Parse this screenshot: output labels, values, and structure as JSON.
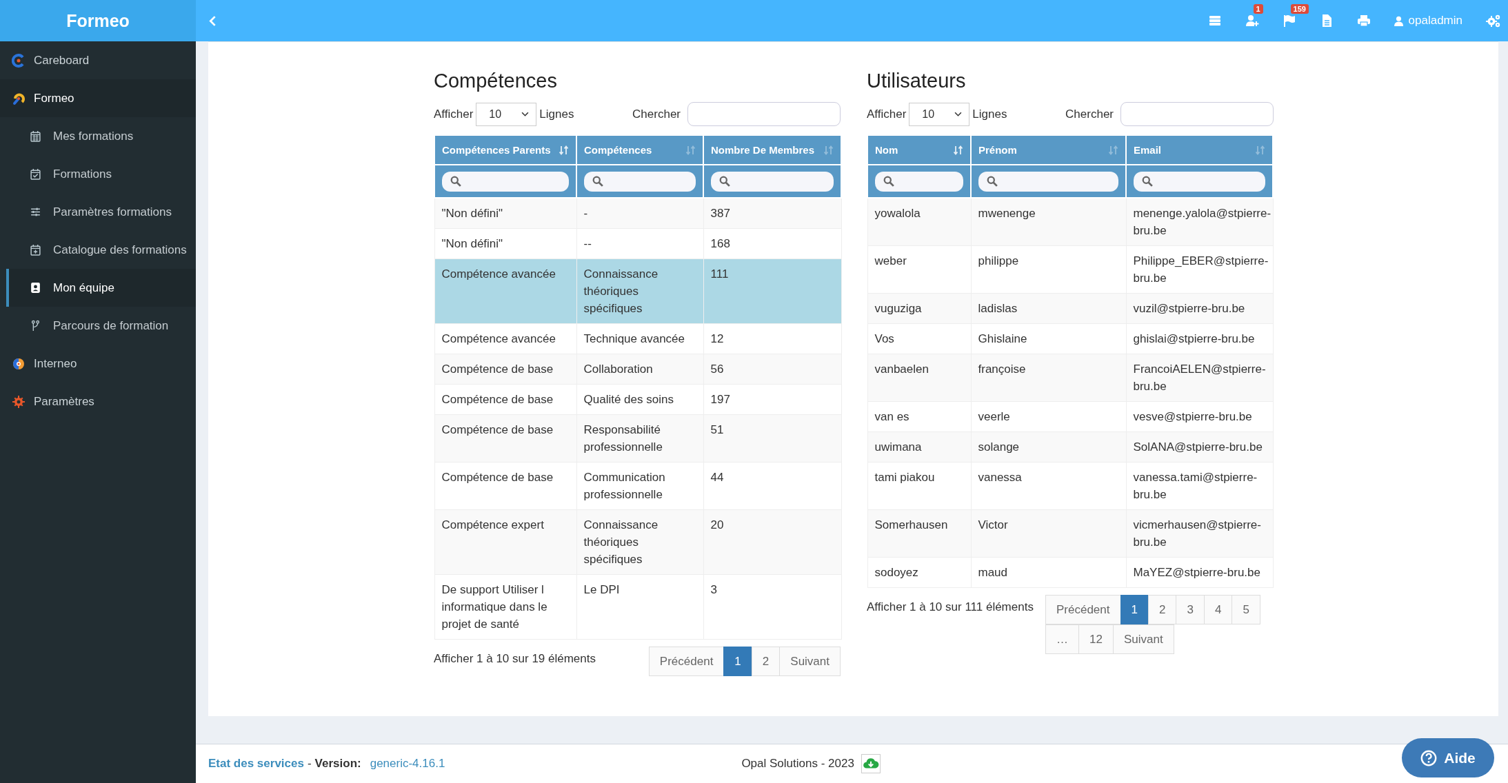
{
  "brand": "Formeo",
  "topbar": {
    "icons": [
      {
        "kind": "list"
      },
      {
        "kind": "user-plus",
        "badge": "1"
      },
      {
        "kind": "flag",
        "badge": "159"
      },
      {
        "kind": "file"
      },
      {
        "kind": "print"
      }
    ],
    "user": "opaladmin"
  },
  "sidebar": {
    "items": [
      {
        "label": "Careboard",
        "kind": "careboard",
        "expanded": false
      },
      {
        "label": "Formeo",
        "kind": "formeo",
        "expanded": true,
        "children": [
          {
            "label": "Mes formations",
            "kind": "calendar",
            "selected": false
          },
          {
            "label": "Formations",
            "kind": "calendar-check",
            "selected": false
          },
          {
            "label": "Paramètres formations",
            "kind": "sliders",
            "selected": false
          },
          {
            "label": "Catalogue des formations",
            "kind": "calendar-plus",
            "selected": false
          },
          {
            "label": "Mon équipe",
            "kind": "contact",
            "selected": true
          },
          {
            "label": "Parcours de formation",
            "kind": "branch",
            "selected": false
          }
        ]
      },
      {
        "label": "Interneo",
        "kind": "interneo",
        "expanded": false
      },
      {
        "label": "Paramètres",
        "kind": "gear",
        "expanded": false
      }
    ]
  },
  "panels": [
    {
      "title": "Compétences",
      "show_label": "Afficher",
      "page_size": "10",
      "rows_label": "Lignes",
      "search_label": "Chercher",
      "columns": [
        {
          "label": "Compétences Parents",
          "sorted": true
        },
        {
          "label": "Compétences",
          "sorted": false
        },
        {
          "label": "Nombre De Membres",
          "sorted": false
        }
      ],
      "rows": [
        {
          "cells": [
            "\"Non défini\"",
            "-",
            "387"
          ],
          "selected": false
        },
        {
          "cells": [
            "\"Non défini\"",
            "--",
            "168"
          ],
          "selected": false
        },
        {
          "cells": [
            "Compétence avancée",
            "Connaissance théoriques spécifiques",
            "111"
          ],
          "selected": true
        },
        {
          "cells": [
            "Compétence avancée",
            "Technique avancée",
            "12"
          ],
          "selected": false
        },
        {
          "cells": [
            "Compétence de base",
            "Collaboration",
            "56"
          ],
          "selected": false
        },
        {
          "cells": [
            "Compétence de base",
            "Qualité des soins",
            "197"
          ],
          "selected": false
        },
        {
          "cells": [
            "Compétence de base",
            "Responsabilité professionnelle",
            "51"
          ],
          "selected": false
        },
        {
          "cells": [
            "Compétence de base",
            "Communication professionnelle",
            "44"
          ],
          "selected": false
        },
        {
          "cells": [
            "Compétence expert",
            "Connaissance théoriques spécifiques",
            "20"
          ],
          "selected": false
        },
        {
          "cells": [
            "De support Utiliser l informatique dans le projet de santé",
            "Le DPI",
            "3"
          ],
          "selected": false
        }
      ],
      "info": "Afficher 1 à 10 sur 19 éléments",
      "pagination": [
        {
          "label": "Précédent",
          "selected": false
        },
        {
          "label": "1",
          "selected": true
        },
        {
          "label": "2",
          "selected": false
        },
        {
          "label": "Suivant",
          "selected": false
        }
      ]
    },
    {
      "title": "Utilisateurs",
      "show_label": "Afficher",
      "page_size": "10",
      "rows_label": "Lignes",
      "search_label": "Chercher",
      "columns": [
        {
          "label": "Nom",
          "sorted": true
        },
        {
          "label": "Prénom",
          "sorted": false
        },
        {
          "label": "Email",
          "sorted": false
        }
      ],
      "rows": [
        {
          "cells": [
            "yowalola",
            "mwenenge",
            "menenge.yalola@stpierre-bru.be"
          ],
          "selected": false
        },
        {
          "cells": [
            "weber",
            "philippe",
            "Philippe_EBER@stpierre-bru.be"
          ],
          "selected": false
        },
        {
          "cells": [
            "vuguziga",
            "ladislas",
            "vuzil@stpierre-bru.be"
          ],
          "selected": false
        },
        {
          "cells": [
            "Vos",
            "Ghislaine",
            "ghislai@stpierre-bru.be"
          ],
          "selected": false
        },
        {
          "cells": [
            "vanbaelen",
            "françoise",
            "FrancoiAELEN@stpierre-bru.be"
          ],
          "selected": false
        },
        {
          "cells": [
            "van es",
            "veerle",
            "vesve@stpierre-bru.be"
          ],
          "selected": false
        },
        {
          "cells": [
            "uwimana",
            "solange",
            "SolANA@stpierre-bru.be"
          ],
          "selected": false
        },
        {
          "cells": [
            "tami piakou",
            "vanessa",
            "vanessa.tami@stpierre-bru.be"
          ],
          "selected": false
        },
        {
          "cells": [
            "Somerhausen",
            "Victor",
            "vicmerhausen@stpierre-bru.be"
          ],
          "selected": false
        },
        {
          "cells": [
            "sodoyez",
            "maud",
            "MaYEZ@stpierre-bru.be"
          ],
          "selected": false
        }
      ],
      "info": "Afficher 1 à 10 sur 111 éléments",
      "pagination": [
        {
          "label": "Précédent",
          "selected": false
        },
        {
          "label": "1",
          "selected": true
        },
        {
          "label": "2",
          "selected": false
        },
        {
          "label": "3",
          "selected": false
        },
        {
          "label": "4",
          "selected": false
        },
        {
          "label": "5",
          "selected": false
        },
        {
          "label": "…",
          "selected": false
        },
        {
          "label": "12",
          "selected": false
        },
        {
          "label": "Suivant",
          "selected": false
        }
      ]
    }
  ],
  "footer": {
    "status_link": "Etat des services",
    "separator": "-",
    "version_label": "Version:",
    "version": "generic-4.16.1",
    "copyright": "Opal Solutions - 2023"
  },
  "help_button": "Aide"
}
